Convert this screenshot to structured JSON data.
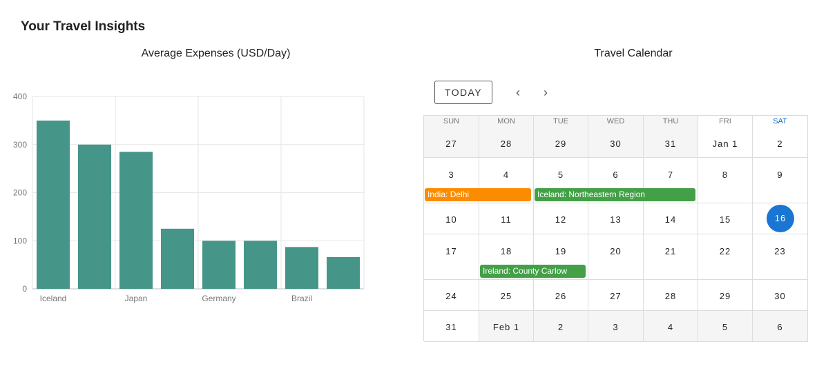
{
  "page": {
    "title": "Your Travel Insights"
  },
  "chart": {
    "section_title": "Average Expenses (USD/Day)"
  },
  "chart_data": {
    "type": "bar",
    "title": "Average Expenses (USD/Day)",
    "categories": [
      "Iceland",
      "",
      "Japan",
      "",
      "Germany",
      "",
      "Brazil",
      ""
    ],
    "values": [
      350,
      300,
      285,
      125,
      100,
      100,
      87,
      66
    ],
    "ylim": [
      0,
      400
    ],
    "yticks": [
      0,
      100,
      200,
      300,
      400
    ],
    "grid": true,
    "bar_color": "#459689"
  },
  "calendar": {
    "section_title": "Travel Calendar",
    "today_label": "TODAY",
    "prev_icon": "chevron-left-icon",
    "next_icon": "chevron-right-icon",
    "weekdays": [
      "SUN",
      "MON",
      "TUE",
      "WED",
      "THU",
      "FRI",
      "SAT"
    ],
    "weeks": [
      [
        "27",
        "28",
        "29",
        "30",
        "31",
        "Jan 1",
        "2"
      ],
      [
        "3",
        "4",
        "5",
        "6",
        "7",
        "8",
        "9"
      ],
      [
        "10",
        "11",
        "12",
        "13",
        "14",
        "15",
        "16"
      ],
      [
        "17",
        "18",
        "19",
        "20",
        "21",
        "22",
        "23"
      ],
      [
        "24",
        "25",
        "26",
        "27",
        "28",
        "29",
        "30"
      ],
      [
        "31",
        "Feb 1",
        "2",
        "3",
        "4",
        "5",
        "6"
      ]
    ],
    "today": "16",
    "colors": {
      "today": "#1976d2",
      "saturday": "#1565c0"
    },
    "events": [
      {
        "label": "India: Delhi",
        "color": "#fb8c00"
      },
      {
        "label": "Iceland: Northeastern Region",
        "color": "#43a047"
      },
      {
        "label": "Ireland: County Carlow",
        "color": "#43a047"
      }
    ]
  }
}
